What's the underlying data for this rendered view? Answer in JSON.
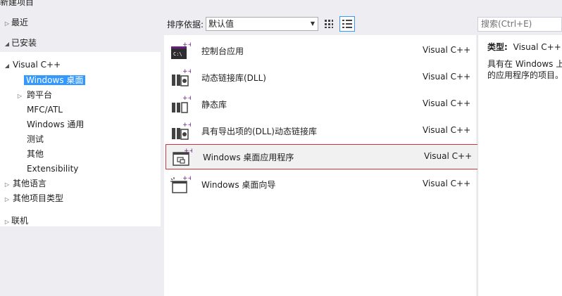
{
  "window": {
    "title": "新建项目"
  },
  "tree": {
    "recent": "最近",
    "installed": "已安装",
    "visual_cpp": "Visual C++",
    "children": [
      "Windows 桌面",
      "跨平台",
      "MFC/ATL",
      "Windows 通用",
      "测试",
      "其他",
      "Extensibility"
    ],
    "other_languages": "其他语言",
    "other_project_types": "其他项目类型",
    "online": "联机"
  },
  "toolbar": {
    "sort_label": "排序依据:",
    "sort_value": "默认值",
    "view_small_icons": "small-icons-view-icon",
    "view_list": "list-view-icon"
  },
  "search": {
    "placeholder": "搜索(Ctrl+E)"
  },
  "templates": [
    {
      "name": "控制台应用",
      "language": "Visual C++",
      "icon": "console-app-icon"
    },
    {
      "name": "动态链接库(DLL)",
      "language": "Visual C++",
      "icon": "dll-icon"
    },
    {
      "name": "静态库",
      "language": "Visual C++",
      "icon": "static-lib-icon"
    },
    {
      "name": "具有导出项的(DLL)动态链接库",
      "language": "Visual C++",
      "icon": "dll-export-icon"
    },
    {
      "name": "Windows 桌面应用程序",
      "language": "Visual C++",
      "icon": "desktop-app-icon"
    },
    {
      "name": "Windows 桌面向导",
      "language": "Visual C++",
      "icon": "desktop-wizard-icon"
    }
  ],
  "details": {
    "type_label": "类型:",
    "type_value": "Visual C++",
    "description_line1": "具有在 Windows 上",
    "description_line2": "的应用程序的项目。"
  },
  "colors": {
    "selection": "#3399ff",
    "highlight_border": "#d13438",
    "plus_accent": "#68217a"
  }
}
